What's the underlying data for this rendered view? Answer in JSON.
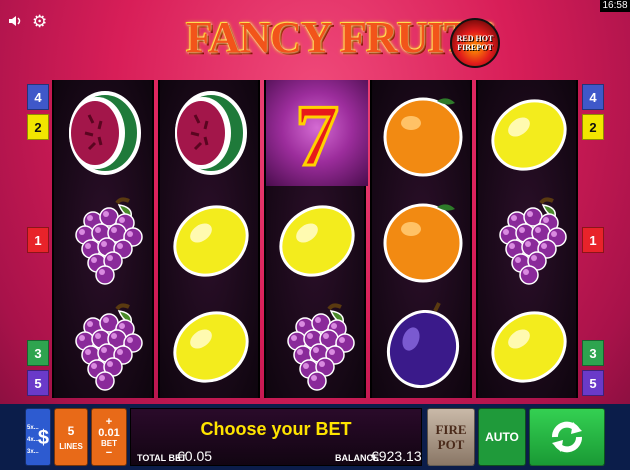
{
  "status": {
    "clock": "16:58"
  },
  "header": {
    "title": "FANCY FRUITS",
    "badge_line1": "RED HOT",
    "badge_line2": "FIREPOT"
  },
  "line_markers": {
    "left": [
      "4",
      "2",
      "1",
      "3",
      "5"
    ],
    "right": [
      "4",
      "2",
      "1",
      "3",
      "5"
    ]
  },
  "reels": [
    [
      "watermelon",
      "grapes",
      "grapes"
    ],
    [
      "watermelon",
      "lemon",
      "lemon"
    ],
    [
      "seven",
      "lemon",
      "grapes"
    ],
    [
      "orange",
      "orange",
      "plum"
    ],
    [
      "lemon",
      "grapes",
      "lemon"
    ]
  ],
  "controls": {
    "paytable_lines": [
      "5x...",
      "4x...",
      "3x..."
    ],
    "paytable_symbol": "$",
    "lines_value": "5",
    "lines_label": "LINES",
    "bet_plus": "+",
    "bet_value": "0.01",
    "bet_label": "BET",
    "bet_minus": "−",
    "message": "Choose your BET",
    "total_bet_label": "TOTAL BET",
    "total_bet_value": "€0.05",
    "balance_label": "BALANCE",
    "balance_value": "€923.13",
    "firepot_line1": "FIRE",
    "firepot_line2": "POT",
    "auto_label": "AUTO"
  },
  "colors": {
    "marker_blue": "#3f58c9",
    "marker_yellow": "#f2e600",
    "marker_red": "#e8232a",
    "marker_green": "#2ea44f",
    "marker_purple": "#6a3ac9",
    "lines_button": "#e86a18",
    "bet_button": "#e86a18",
    "paytable_button": "#2d5bd0",
    "auto_button": "#1f9a3a",
    "spin_button": "#23b43f",
    "message_text": "#ffe400"
  }
}
